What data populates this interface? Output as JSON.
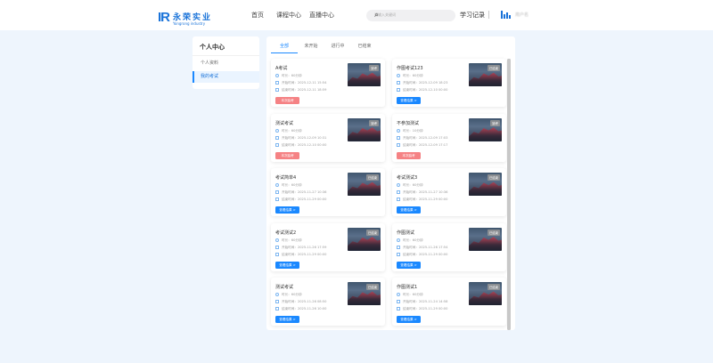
{
  "header": {
    "logo_mark": "IR",
    "logo_cn": "永荣实业",
    "logo_en": "Yongrong industry",
    "nav": [
      "首页",
      "课程中心",
      "直播中心"
    ],
    "search_placeholder": "请输入关键词",
    "learning_record": "学习记录",
    "username": "用户名"
  },
  "sidebar": {
    "title": "个人中心",
    "items": [
      "个人资料",
      "我的考试"
    ]
  },
  "tabs": [
    "全部",
    "未开始",
    "进行中",
    "已结束"
  ],
  "labels": {
    "duration": "时长：",
    "start": "开始时间：",
    "end": "结束时间："
  },
  "exams": [
    {
      "title": "A考试",
      "duration": "60分钟",
      "start": "2025-12-11 15:54",
      "end": "2025-12-11 18:59",
      "badge": "缺考",
      "action": "本次缺考",
      "status": "absent"
    },
    {
      "title": "作图考试123",
      "duration": "60分钟",
      "start": "2025-12-09 18:23",
      "end": "2025-12-10 00:00",
      "badge": "已结束",
      "action": "查看结果 >",
      "status": "ended"
    },
    {
      "title": "测试考试",
      "duration": "60分钟",
      "start": "2025-12-09 10:31",
      "end": "2025-12-10 00:00",
      "badge": "缺考",
      "action": "本次缺考",
      "status": "absent"
    },
    {
      "title": "不参加测试",
      "duration": "10分钟",
      "start": "2025-12-09 17:03",
      "end": "2025-12-09 17:17",
      "badge": "缺考",
      "action": "本次缺考",
      "status": "absent"
    },
    {
      "title": "考试简单4",
      "duration": "60分钟",
      "start": "2025-11-27 10:36",
      "end": "2025-11-29 00:00",
      "badge": "已结束",
      "action": "查看结果 >",
      "status": "ended"
    },
    {
      "title": "考试测试3",
      "duration": "60分钟",
      "start": "2025-11-27 10:36",
      "end": "2025-11-29 00:00",
      "badge": "已结束",
      "action": "查看结果 >",
      "status": "ended"
    },
    {
      "title": "考试测试2",
      "duration": "60分钟",
      "start": "2025-11-26 17:59",
      "end": "2025-11-29 00:00",
      "badge": "已结束",
      "action": "查看结果 >",
      "status": "ended"
    },
    {
      "title": "作图测试",
      "duration": "60分钟",
      "start": "2025-11-26 17:54",
      "end": "2025-11-29 00:00",
      "badge": "已结束",
      "action": "查看结果 >",
      "status": "ended"
    },
    {
      "title": "测试考试",
      "duration": "60分钟",
      "start": "2025-11-26 08:50",
      "end": "2025-11-26 10:00",
      "badge": "已结束",
      "action": "查看结果 >",
      "status": "ended"
    },
    {
      "title": "作图测试1",
      "duration": "60分钟",
      "start": "2025-11-24 14:58",
      "end": "2025-11-29 00:00",
      "badge": "已结束",
      "action": "查看结果 >",
      "status": "ended"
    }
  ],
  "colors": {
    "accent": "#1a88ff",
    "absent": "#f58284",
    "background": "#eef5fd"
  }
}
